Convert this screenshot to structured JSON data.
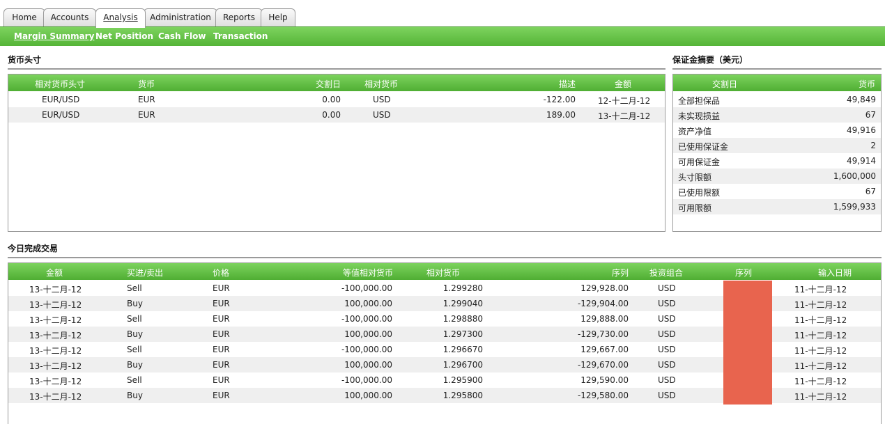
{
  "tabs": [
    {
      "label": "Home",
      "active": false
    },
    {
      "label": "Accounts",
      "active": false
    },
    {
      "label": "Analysis",
      "active": true
    },
    {
      "label": "Administration",
      "active": false
    },
    {
      "label": "Reports",
      "active": false
    },
    {
      "label": "Help",
      "active": false
    }
  ],
  "subnav": [
    "Margin Summary",
    "Net Position",
    "Cash Flow",
    "Transaction"
  ],
  "currency_position": {
    "title": "货币头寸",
    "headers": [
      "相对货币头寸",
      "货币",
      "交割日",
      "相对货币",
      "描述",
      "金额"
    ],
    "rows": [
      [
        "EUR/USD",
        "EUR",
        "0.00",
        "USD",
        "-122.00",
        "12-十二月-12"
      ],
      [
        "EUR/USD",
        "EUR",
        "0.00",
        "USD",
        "189.00",
        "13-十二月-12"
      ]
    ]
  },
  "margin_summary": {
    "title": "保证金摘要（美元）",
    "headers": [
      "交割日",
      "货币"
    ],
    "rows": [
      [
        "全部担保品",
        "49,849"
      ],
      [
        "未实现损益",
        "67"
      ],
      [
        "资产净值",
        "49,916"
      ],
      [
        "已使用保证金",
        "2"
      ],
      [
        "可用保证金",
        "49,914"
      ],
      [
        "头寸限额",
        "1,600,000"
      ],
      [
        "已使用限额",
        "67"
      ],
      [
        "可用限额",
        "1,599,933"
      ]
    ]
  },
  "trades": {
    "title": "今日完成交易",
    "headers": [
      "金额",
      "买进/卖出",
      "价格",
      "等值相对货币",
      "相对货币",
      "序列",
      "投资组合",
      "序列",
      "输入日期"
    ],
    "rows": [
      [
        "13-十二月-12",
        "Sell",
        "EUR",
        "-100,000.00",
        "1.299280",
        "129,928.00",
        "USD",
        "11-十二月-12"
      ],
      [
        "13-十二月-12",
        "Buy",
        "EUR",
        "100,000.00",
        "1.299040",
        "-129,904.00",
        "USD",
        "11-十二月-12"
      ],
      [
        "13-十二月-12",
        "Sell",
        "EUR",
        "-100,000.00",
        "1.298880",
        "129,888.00",
        "USD",
        "11-十二月-12"
      ],
      [
        "13-十二月-12",
        "Buy",
        "EUR",
        "100,000.00",
        "1.297300",
        "-129,730.00",
        "USD",
        "11-十二月-12"
      ],
      [
        "13-十二月-12",
        "Sell",
        "EUR",
        "-100,000.00",
        "1.296670",
        "129,667.00",
        "USD",
        "11-十二月-12"
      ],
      [
        "13-十二月-12",
        "Buy",
        "EUR",
        "100,000.00",
        "1.296700",
        "-129,670.00",
        "USD",
        "11-十二月-12"
      ],
      [
        "13-十二月-12",
        "Sell",
        "EUR",
        "-100,000.00",
        "1.295900",
        "129,590.00",
        "USD",
        "11-十二月-12"
      ],
      [
        "13-十二月-12",
        "Buy",
        "EUR",
        "100,000.00",
        "1.295800",
        "-129,580.00",
        "USD",
        "11-十二月-12"
      ]
    ]
  },
  "colors": {
    "accent_green": "#5cb83e",
    "redaction": "#e8644e"
  }
}
